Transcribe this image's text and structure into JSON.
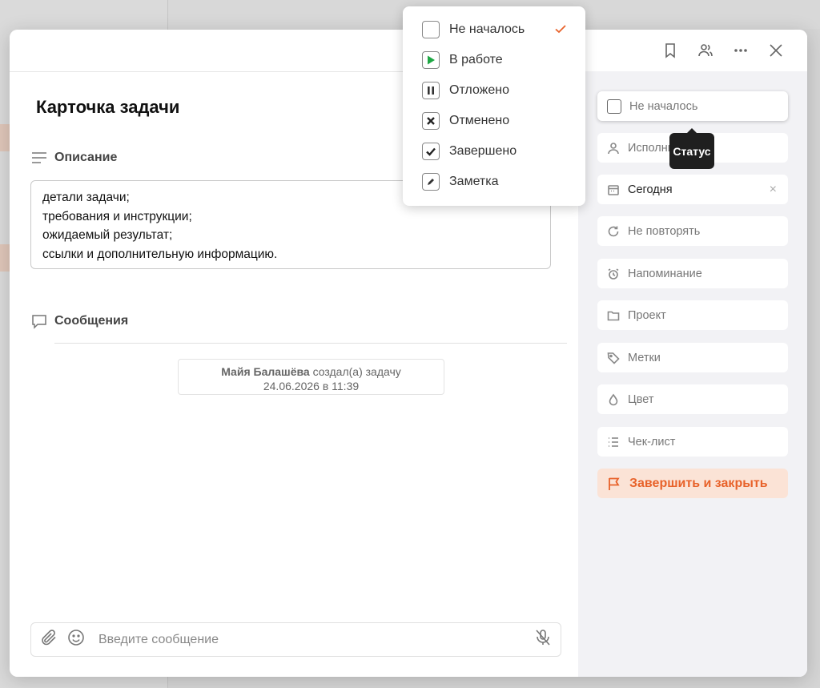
{
  "header_icons": [
    "bookmark-icon",
    "participants-icon",
    "more-icon",
    "close-icon"
  ],
  "task": {
    "title": "Карточка задачи"
  },
  "description": {
    "label": "Описание",
    "lines": [
      "детали задачи;",
      "требования и инструкции;",
      "ожидаемый результат;",
      "ссылки и дополнительную информацию."
    ]
  },
  "messages": {
    "label": "Сообщения",
    "system": {
      "author": "Майя Балашёва",
      "action": "создал(а) задачу",
      "datetime": "24.06.2026 в 11:39"
    },
    "composer_placeholder": "Введите сообщение"
  },
  "fields": {
    "status": "Не началось",
    "assignee": "Исполнитель",
    "date": "Сегодня",
    "date_clear": "×",
    "repeat": "Не повторять",
    "reminder": "Напоминание",
    "project": "Проект",
    "tags": "Метки",
    "color": "Цвет",
    "checklist": "Чек-лист",
    "finish": "Завершить и закрыть"
  },
  "tooltip": "Статус",
  "status_menu": {
    "selected": "Не началось",
    "items": [
      {
        "label": "Не началось",
        "icon": "empty-checkbox-icon"
      },
      {
        "label": "В работе",
        "icon": "play-icon"
      },
      {
        "label": "Отложено",
        "icon": "pause-icon"
      },
      {
        "label": "Отменено",
        "icon": "cross-icon"
      },
      {
        "label": "Завершено",
        "icon": "check-icon"
      },
      {
        "label": "Заметка",
        "icon": "pencil-icon"
      }
    ]
  },
  "colors": {
    "accent": "#e8622a",
    "accent_bg": "#fbe3d6",
    "in_progress": "#1fa845",
    "panel_bg": "#f2f2f5"
  }
}
